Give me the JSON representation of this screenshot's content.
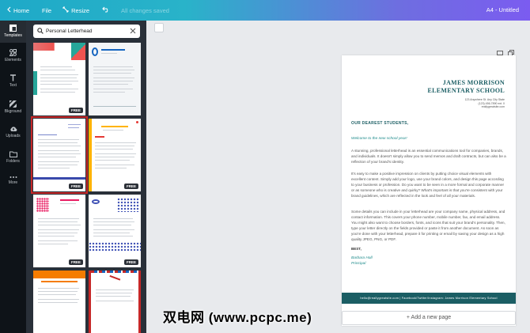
{
  "topbar": {
    "home": "Home",
    "file": "File",
    "resize": "Resize",
    "save_status": "All changes saved",
    "doc_title": "A4 - Untitled"
  },
  "rail": {
    "items": [
      {
        "label": "Templates",
        "icon": "templates-icon"
      },
      {
        "label": "Elements",
        "icon": "elements-icon"
      },
      {
        "label": "Text",
        "icon": "text-icon"
      },
      {
        "label": "Bkground",
        "icon": "background-icon"
      },
      {
        "label": "Uploads",
        "icon": "uploads-icon"
      },
      {
        "label": "Folders",
        "icon": "folders-icon"
      },
      {
        "label": "More",
        "icon": "more-icon"
      }
    ]
  },
  "search": {
    "value": "Personal Letterhead"
  },
  "templates": {
    "badge": "FREE"
  },
  "canvas": {
    "add_page": "+ Add a new page"
  },
  "letter": {
    "name_line1": "JAMES MORRISON",
    "name_line2": "ELEMENTARY SCHOOL",
    "contact1": "123 Anywhere St. Any City State",
    "contact2": "(123) 456-7890 ext. 0",
    "contact3": "reallygreatsite.com",
    "greeting": "OUR DEAREST STUDENTS,",
    "welcome": "Welcome to the new school year!",
    "para1": "A stunning, professional letterhead is an essential communications tool for companies, brands, and individuals. It doesn't simply allow you to send memos and draft contracts, but can also be a reflection of your brand's identity.",
    "para2": "It's easy to make a positive impression on clients by putting choice visual elements with excellent content. Simply add your logo, use your brand colors, and design this page according to your business or profession. Do you want to be seen in a more formal and corporate manner or as someone who is creative and quirky? What's important is that you're consistent with your brand guidelines, which are reflected in the look and feel of all your materials.",
    "para3": "Some details you can include in your letterhead are your company name, physical address, and contact information. This covers your phone number, mobile number, fax, and email address. You might also want to choose borders, fonts, and icons that suit your brand's personality. Then, type your letter directly on the fields provided or paste it from another document. As soon as you're done with your letterhead, prepare it for printing or email by saving your design as a high quality JPEG, PNG, or PDF.",
    "closing": "BEST,",
    "signer": "Barbara Hall",
    "signer_title": "Principal",
    "footer": "hello@reallygreatsite.com  |  Facebook/Twitter/Instagram: James Morrison Elementary School"
  },
  "watermark": "双电网 (www.pcpc.me)"
}
